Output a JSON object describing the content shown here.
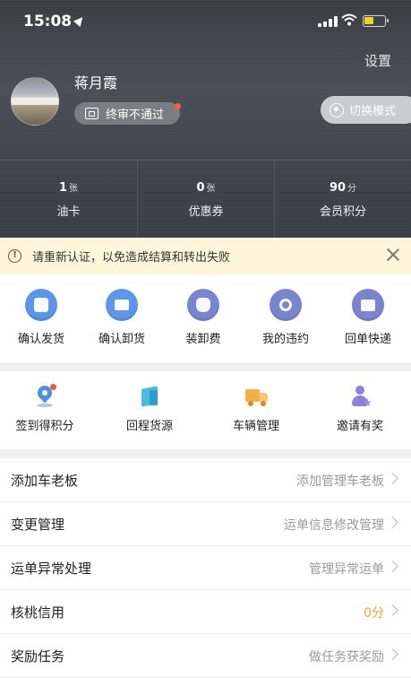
{
  "status_bar": {
    "time": "15:08"
  },
  "header": {
    "settings_label": "设置",
    "user_name": "蒋月霞",
    "verify_status": "终审不通过",
    "switch_mode_label": "切换模式",
    "stats": [
      {
        "value": "1",
        "unit": "张",
        "label": "油卡"
      },
      {
        "value": "0",
        "unit": "张",
        "label": "优惠券"
      },
      {
        "value": "90",
        "unit": "分",
        "label": "会员积分"
      }
    ]
  },
  "notice": {
    "text": "请重新认证，以免造成结算和转出失败"
  },
  "quick_actions": [
    {
      "label": "确认发货",
      "icon": "document-icon"
    },
    {
      "label": "确认卸货",
      "icon": "unload-icon"
    },
    {
      "label": "装卸费",
      "icon": "money-bag-icon"
    },
    {
      "label": "我的违约",
      "icon": "magnifier-icon"
    },
    {
      "label": "回单快递",
      "icon": "receipt-box-icon"
    }
  ],
  "services": [
    {
      "label": "签到得积分",
      "icon": "location-pin-icon"
    },
    {
      "label": "回程货源",
      "icon": "cube-icon"
    },
    {
      "label": "车辆管理",
      "icon": "truck-icon"
    },
    {
      "label": "邀请有奖",
      "icon": "person-star-icon"
    }
  ],
  "menu": [
    {
      "label": "添加车老板",
      "value": "添加管理车老板"
    },
    {
      "label": "变更管理",
      "value": "运单信息修改管理"
    },
    {
      "label": "运单异常处理",
      "value": "管理异常运单"
    },
    {
      "label": "核桃信用",
      "value": "0分"
    },
    {
      "label": "奖励任务",
      "value": "做任务获奖励"
    }
  ],
  "colors": {
    "accent_orange": "#f0a33a",
    "notice_bg": "#fdf6da",
    "icon_blue": "#5d95ea"
  }
}
